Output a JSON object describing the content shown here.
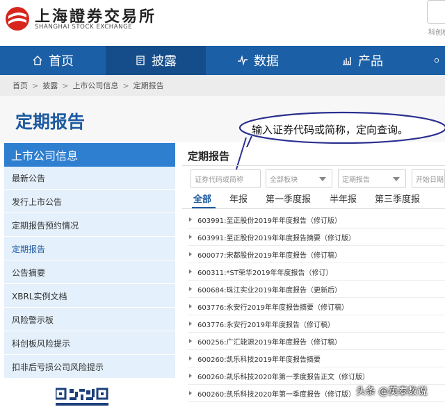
{
  "header": {
    "logo_cn": "上海證券交易所",
    "logo_en": "SHANGHAI STOCK EXCHANGE",
    "search_hint": "科创板",
    "logo_icon": "sse-logo-icon",
    "colors": {
      "brand_red": "#d7261e",
      "nav_blue": "#1b5fa6",
      "accent_blue": "#2f7fd0"
    }
  },
  "nav": {
    "items": [
      {
        "label": "首页",
        "icon": "home-icon"
      },
      {
        "label": "披露",
        "icon": "document-icon"
      },
      {
        "label": "数据",
        "icon": "pulse-icon"
      },
      {
        "label": "产品",
        "icon": "bar-chart-icon"
      }
    ],
    "active": "披露"
  },
  "breadcrumb": [
    "首页",
    "披露",
    "上市公司信息",
    "定期报告"
  ],
  "page_title": "定期报告",
  "callout": "输入证券代码或简称，定向查询。",
  "sidebar": {
    "heading": "上市公司信息",
    "items": [
      "最新公告",
      "发行上市公告",
      "定期报告预约情况",
      "定期报告",
      "公告摘要",
      "XBRL实例文档",
      "风险警示板",
      "科创板风险提示",
      "扣非后亏损公司风险提示"
    ],
    "active": "定期报告"
  },
  "main": {
    "title": "定期报告",
    "filters": {
      "code_placeholder": "证券代码或简称",
      "board": "全部板块",
      "report_type": "定期报告",
      "start_date": "开始日期"
    },
    "tabs": [
      "全部",
      "年报",
      "第一季度报",
      "半年报",
      "第三季度报"
    ],
    "active_tab": "全部",
    "reports": [
      "603991:至正股份2019年年度报告（修订版）",
      "603991:至正股份2019年年度报告摘要（修订版）",
      "600077:宋都股份2019年年度报告（修订稿）",
      "600311:*ST荣华2019年年度报告（修订）",
      "600684:珠江实业2019年年度报告（更新后）",
      "603776:永安行2019年年度报告摘要（修订稿）",
      "603776:永安行2019年年度报告（修订稿）",
      "600256:广汇能源2019年年度报告（修订稿）",
      "600260:凯乐科技2019年年度报告摘要",
      "600260:凯乐科技2020年第一季度报告正文（修订版）",
      "600260:凯乐科技2020年第一季度报告（修订版）"
    ]
  },
  "watermark": "头条 @英泰数说"
}
